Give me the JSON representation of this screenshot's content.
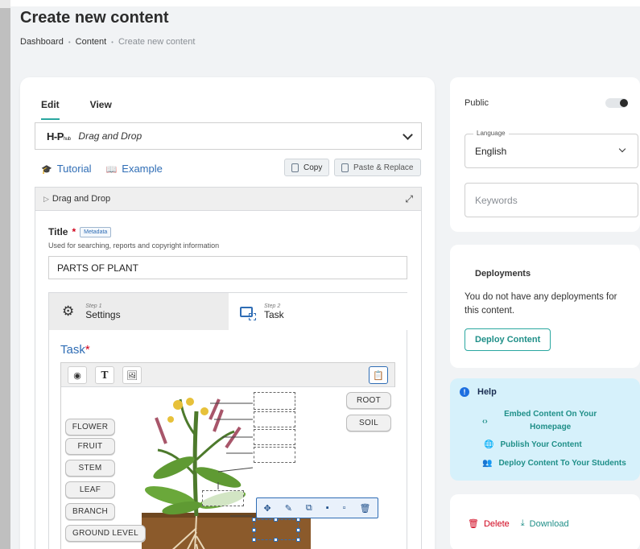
{
  "page": {
    "title": "Create new content",
    "breadcrumb": [
      "Dashboard",
      "Content",
      "Create new content"
    ]
  },
  "editor": {
    "tabs": [
      {
        "label": "Edit",
        "active": true
      },
      {
        "label": "View",
        "active": false
      }
    ],
    "library": {
      "logo": "H-P",
      "logo_sub": "hub",
      "name": "Drag and Drop"
    },
    "links": {
      "tutorial": "Tutorial",
      "example": "Example"
    },
    "buttons": {
      "copy": "Copy",
      "paste": "Paste & Replace"
    },
    "panel_title": "Drag and Drop",
    "title_field": {
      "label": "Title",
      "required_mark": "*",
      "metadata_btn": "Metadata",
      "description": "Used for searching, reports and copyright information",
      "value": "PARTS OF PLANT"
    },
    "steps": [
      {
        "small": "Step 1",
        "label": "Settings"
      },
      {
        "small": "Step 2",
        "label": "Task"
      }
    ],
    "task_label": "Task",
    "task_required": "*",
    "toolbar": {
      "text_btn": "T"
    },
    "drag_items_left": [
      "FLOWER",
      "FRUIT",
      "STEM",
      "LEAF",
      "BRANCH",
      "GROUND LEVEL"
    ],
    "drag_items_right": [
      "ROOT",
      "SOIL"
    ]
  },
  "sidebar": {
    "public_label": "Public",
    "language": {
      "legend": "Language",
      "value": "English"
    },
    "keywords_placeholder": "Keywords",
    "deployments": {
      "title": "Deployments",
      "text": "You do not have any deployments for this content.",
      "button": "Deploy Content"
    },
    "help": {
      "title": "Help",
      "items": [
        "Embed Content On Your Homepage",
        "Publish Your Content",
        "Deploy Content To Your Students"
      ]
    },
    "actions": {
      "delete": "Delete",
      "download": "Download"
    }
  },
  "colors": {
    "accent": "#2aa7a0",
    "link": "#2f6db5",
    "danger": "#d0021b",
    "help_bg": "#d6f1fb"
  }
}
